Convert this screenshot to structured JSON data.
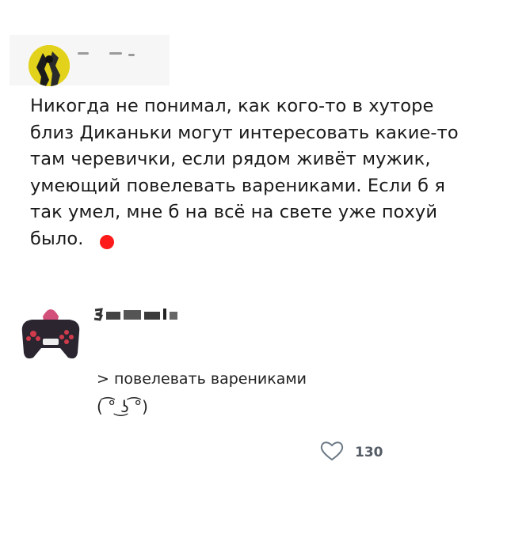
{
  "post": {
    "author_name": "",
    "text": "Никогда не понимал, как кого-то в хуторе близ Диканьки могут интересовать какие-то там черевички, если рядом живёт мужик, умеющий повелевать варениками. Если б я так умел, мне б на всё на свете уже похуй было."
  },
  "comment": {
    "author_name": "",
    "quote": "> повелевать варениками",
    "face": "( ͡° ͜ʖ ͡°)",
    "likes": "130"
  },
  "colors": {
    "avatar1": "#e2d21c",
    "red_dot": "#ff1a1a",
    "like_count": "#555c66",
    "heart_stroke": "#6d7a86"
  }
}
